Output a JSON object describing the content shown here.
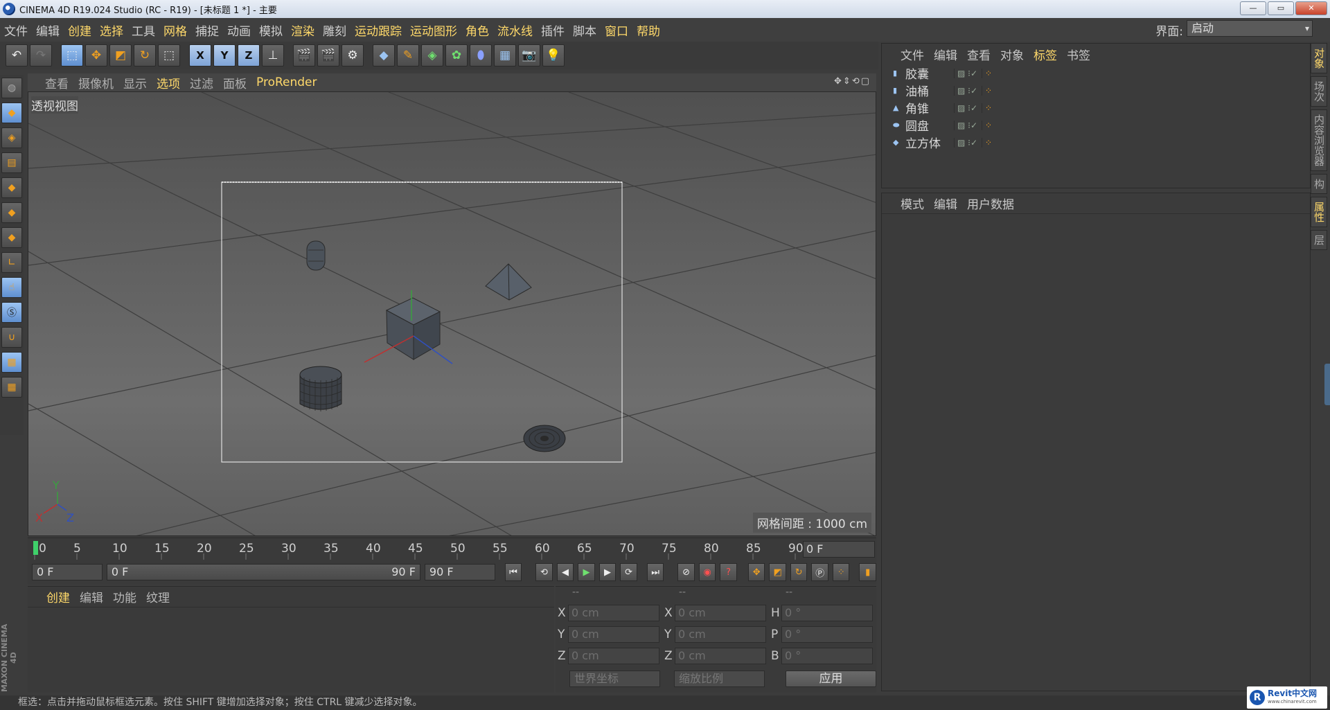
{
  "window": {
    "title": "CINEMA 4D R19.024 Studio (RC - R19) - [未标题 1 *] - 主要",
    "buttons": [
      "—",
      "▭",
      "✕"
    ]
  },
  "menu": {
    "items": [
      "文件",
      "编辑",
      "创建",
      "选择",
      "工具",
      "网格",
      "捕捉",
      "动画",
      "模拟",
      "渲染",
      "雕刻",
      "运动跟踪",
      "运动图形",
      "角色",
      "流水线",
      "插件",
      "脚本",
      "窗口",
      "帮助"
    ],
    "layout_label": "界面:",
    "layout_value": "启动"
  },
  "toolbar": {
    "axis_x": "X",
    "axis_y": "Y",
    "axis_z": "Z"
  },
  "viewport": {
    "menu": [
      "查看",
      "摄像机",
      "显示",
      "选项",
      "过滤",
      "面板",
      "ProRender"
    ],
    "label": "透视视图",
    "grid_spacing": "网格间距 : 1000 cm",
    "axis_labels": {
      "x": "X",
      "y": "Y",
      "z": "Z"
    }
  },
  "timeline": {
    "ticks": [
      "0",
      "5",
      "10",
      "15",
      "20",
      "25",
      "30",
      "35",
      "40",
      "45",
      "50",
      "55",
      "60",
      "65",
      "70",
      "75",
      "80",
      "85",
      "90"
    ],
    "current_frame": "0 F",
    "start_frame": "0 F",
    "range_start": "0 F",
    "range_end": "90 F",
    "end_frame": "90 F"
  },
  "material_panel": {
    "menu": [
      "创建",
      "编辑",
      "功能",
      "纹理"
    ]
  },
  "coordinates": {
    "headers": [
      "--",
      "--",
      "--"
    ],
    "rows": [
      {
        "l1": "X",
        "v1": "0 cm",
        "l2": "X",
        "v2": "0 cm",
        "l3": "H",
        "v3": "0 °"
      },
      {
        "l1": "Y",
        "v1": "0 cm",
        "l2": "Y",
        "v2": "0 cm",
        "l3": "P",
        "v3": "0 °"
      },
      {
        "l1": "Z",
        "v1": "0 cm",
        "l2": "Z",
        "v2": "0 cm",
        "l3": "B",
        "v3": "0 °"
      }
    ],
    "world_coords": "世界坐标",
    "scale": "缩放比例",
    "apply": "应用"
  },
  "object_manager": {
    "menu": [
      "文件",
      "编辑",
      "查看",
      "对象",
      "标签",
      "书签"
    ],
    "objects": [
      {
        "name": "胶囊",
        "icon": "capsule-icon"
      },
      {
        "name": "油桶",
        "icon": "oil-tank-icon"
      },
      {
        "name": "角锥",
        "icon": "pyramid-icon"
      },
      {
        "name": "圆盘",
        "icon": "disc-icon"
      },
      {
        "name": "立方体",
        "icon": "cube-icon"
      }
    ]
  },
  "attribute_manager": {
    "menu": [
      "模式",
      "编辑",
      "用户数据"
    ]
  },
  "side_tabs": [
    "对象",
    "场次",
    "内容浏览器",
    "构",
    "属性",
    "层"
  ],
  "status": {
    "text": "框选：点击并拖动鼠标框选元素。按住 SHIFT 键增加选择对象；按住 CTRL 键减少选择对象。"
  },
  "branding": {
    "maxon": "MAXON CINEMA 4D",
    "watermark_title": "Revit中文网",
    "watermark_url": "www.chinarevit.com"
  },
  "colors": {
    "accent_yellow": "#ffd96a",
    "ui_bg": "#3c3c3c",
    "viewport_bg": "#5e5e5e",
    "selection_blue": "#7ea3d6"
  }
}
